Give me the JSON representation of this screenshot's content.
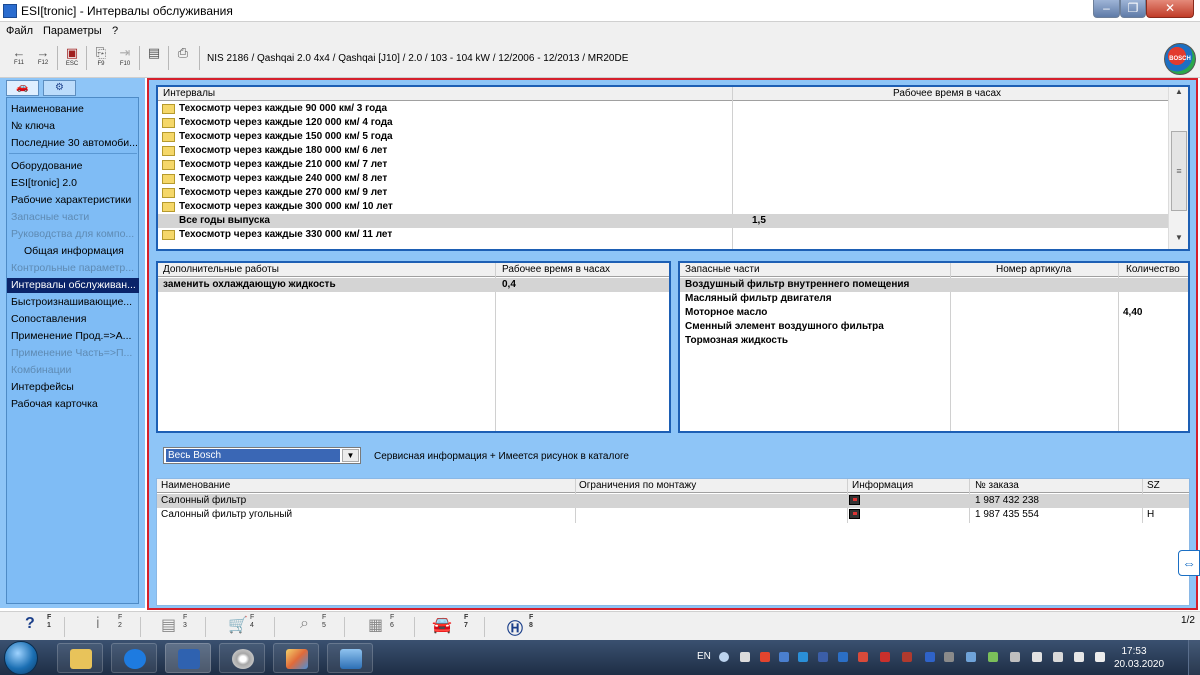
{
  "window": {
    "title": "ESI[tronic] - Интервалы обслуживания"
  },
  "menu": [
    "Файл",
    "Параметры",
    "?"
  ],
  "toolbar": {
    "back_key": "F11",
    "forward_key": "F12",
    "esc_key": "ESC",
    "f9_key": "F9",
    "f10_key": "F10",
    "vehicle": "NIS 2186 / Qashqai 2.0 4x4 / Qashqai [J10] / 2.0 / 103 - 104 kW / 12/2006 - 12/2013 / MR20DE",
    "logo": "BOSCH"
  },
  "sidebar": {
    "tabs": [
      "car-icon",
      "engine-icon"
    ],
    "items": [
      {
        "label": "Наименование",
        "state": "normal"
      },
      {
        "label": "№ ключа",
        "state": "normal"
      },
      {
        "label": "Последние 30 автомоби...",
        "state": "normal"
      },
      {
        "label": "Оборудование",
        "state": "normal"
      },
      {
        "label": "ESI[tronic] 2.0",
        "state": "normal"
      },
      {
        "label": "Рабочие характеристики",
        "state": "normal"
      },
      {
        "label": "Запасные части",
        "state": "disabled"
      },
      {
        "label": "Руководства для компо...",
        "state": "disabled"
      },
      {
        "label": "Общая информация",
        "state": "indent"
      },
      {
        "label": "Контрольные параметр...",
        "state": "disabled"
      },
      {
        "label": "Интервалы обслуживан...",
        "state": "active"
      },
      {
        "label": "Быстроизнашивающие...",
        "state": "normal"
      },
      {
        "label": "Сопоставления",
        "state": "normal"
      },
      {
        "label": "Применение Прод.=>А...",
        "state": "normal"
      },
      {
        "label": "Применение Часть=>П...",
        "state": "disabled"
      },
      {
        "label": "Комбинации",
        "state": "disabled"
      },
      {
        "label": "Интерфейсы",
        "state": "normal"
      },
      {
        "label": "Рабочая карточка",
        "state": "normal"
      }
    ]
  },
  "intervals": {
    "headers": [
      "Интервалы",
      "Рабочее время в часах"
    ],
    "rows": [
      {
        "label": "Техосмотр через каждые 90 000 км/ 3 года",
        "hours": ""
      },
      {
        "label": "Техосмотр через каждые 120 000 км/ 4 года",
        "hours": ""
      },
      {
        "label": "Техосмотр через каждые 150 000 км/ 5 года",
        "hours": ""
      },
      {
        "label": "Техосмотр через каждые 180 000 км/ 6 лет",
        "hours": ""
      },
      {
        "label": "Техосмотр через каждые 210 000 км/ 7 лет",
        "hours": ""
      },
      {
        "label": "Техосмотр через каждые 240 000 км/ 8 лет",
        "hours": ""
      },
      {
        "label": "Техосмотр через каждые 270 000 км/ 9 лет",
        "hours": ""
      },
      {
        "label": "Техосмотр через каждые 300 000 км/ 10 лет",
        "hours": ""
      },
      {
        "label": "Все годы выпуска",
        "hours": "1,5"
      },
      {
        "label": "Техосмотр через каждые 330 000 км/ 11 лет",
        "hours": ""
      }
    ]
  },
  "additional_work": {
    "headers": [
      "Дополнительные работы",
      "Рабочее время в часах"
    ],
    "rows": [
      {
        "label": "заменить охлаждающую жидкость",
        "hours": "0,4"
      }
    ]
  },
  "spare_parts": {
    "headers": [
      "Запасные части",
      "Номер артикула",
      "Количество"
    ],
    "rows": [
      {
        "label": "Воздушный фильтр внутреннего помещения",
        "article": "",
        "qty": ""
      },
      {
        "label": "Масляный фильтр двигателя",
        "article": "",
        "qty": ""
      },
      {
        "label": "Моторное масло",
        "article": "",
        "qty": "4,40"
      },
      {
        "label": "Сменный элемент воздушного фильтра",
        "article": "",
        "qty": ""
      },
      {
        "label": "Тормозная жидкость",
        "article": "",
        "qty": ""
      }
    ]
  },
  "filter": {
    "selected": "Весь Bosch",
    "note": "Сервисная информация + Имеется рисунок в каталоге"
  },
  "orders": {
    "headers": [
      "Наименование",
      "Ограничения по монтажу",
      "Информация",
      "№ заказа",
      "SZ"
    ],
    "rows": [
      {
        "name": "Салонный фильтр",
        "restrictions": "",
        "order_no": "1 987 432 238",
        "sz": ""
      },
      {
        "name": "Салонный фильтр угольный",
        "restrictions": "",
        "order_no": "1 987 435 554",
        "sz": "H"
      }
    ]
  },
  "fkeys": [
    {
      "glyph": "?",
      "key": "F",
      "num": "1",
      "active": true
    },
    {
      "glyph": "i",
      "key": "F",
      "num": "2",
      "active": false
    },
    {
      "glyph": "▤",
      "key": "F",
      "num": "3",
      "active": false
    },
    {
      "glyph": "🛒",
      "key": "F",
      "num": "4",
      "active": false
    },
    {
      "glyph": "⌕",
      "key": "F",
      "num": "5",
      "active": false
    },
    {
      "glyph": "▦",
      "key": "F",
      "num": "6",
      "active": false
    },
    {
      "glyph": "🚘",
      "key": "F",
      "num": "7",
      "active": true
    },
    {
      "glyph": "Ⓗ",
      "key": "F",
      "num": "8",
      "active": true
    }
  ],
  "page_indicator": "1/2",
  "taskbar": {
    "lang": "EN",
    "time": "17:53",
    "date": "20.03.2020"
  },
  "colors": {
    "panel_blue": "#8ec5f7",
    "border_red": "#d5202c",
    "selection_dark": "#0a246a"
  }
}
